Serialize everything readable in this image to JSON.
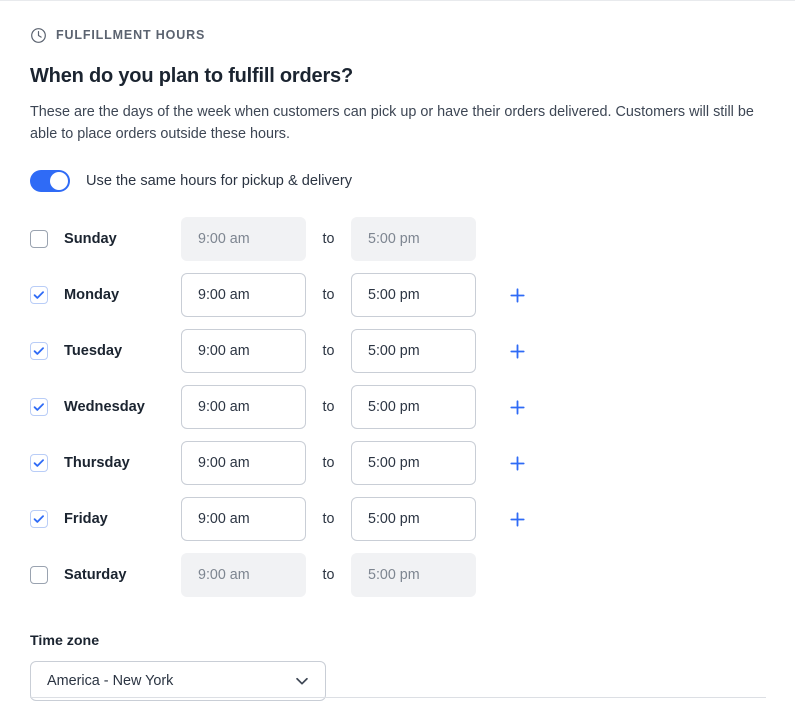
{
  "section": {
    "eyebrow_icon": "clock-icon",
    "eyebrow_label": "FULFILLMENT HOURS",
    "heading": "When do you plan to fulfill orders?",
    "description": "These are the days of the week when customers can pick up or have their orders delivered. Customers will still be able to place orders outside these hours."
  },
  "toggle": {
    "label": "Use the same hours for pickup & delivery",
    "enabled": true,
    "on_color": "#2f6bf6",
    "knob_color": "#ffffff"
  },
  "schedule": {
    "to_label": "to",
    "add_icon": "plus-icon",
    "add_icon_color": "#2f6bf6",
    "rows": [
      {
        "day": "Sunday",
        "checked": false,
        "start": "9:00 am",
        "end": "5:00 pm",
        "has_add": false
      },
      {
        "day": "Monday",
        "checked": true,
        "start": "9:00 am",
        "end": "5:00 pm",
        "has_add": true
      },
      {
        "day": "Tuesday",
        "checked": true,
        "start": "9:00 am",
        "end": "5:00 pm",
        "has_add": true
      },
      {
        "day": "Wednesday",
        "checked": true,
        "start": "9:00 am",
        "end": "5:00 pm",
        "has_add": true
      },
      {
        "day": "Thursday",
        "checked": true,
        "start": "9:00 am",
        "end": "5:00 pm",
        "has_add": true
      },
      {
        "day": "Friday",
        "checked": true,
        "start": "9:00 am",
        "end": "5:00 pm",
        "has_add": true
      },
      {
        "day": "Saturday",
        "checked": false,
        "start": "9:00 am",
        "end": "5:00 pm",
        "has_add": false
      }
    ]
  },
  "timezone": {
    "label": "Time zone",
    "value": "America - New York",
    "chevron_icon": "chevron-down-icon"
  }
}
